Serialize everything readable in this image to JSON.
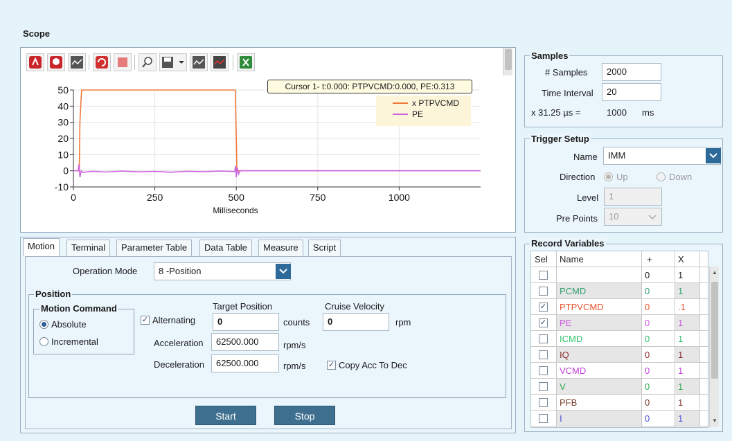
{
  "scope": {
    "title": "Scope"
  },
  "toolbar": {
    "buttons": [
      "record-icon",
      "stop-record-icon",
      "wave-icon",
      "refresh-icon",
      "stop-icon",
      "zoom-icon",
      "save-icon",
      "wave2-icon",
      "wave3-icon",
      "excel-icon"
    ]
  },
  "plot": {
    "cursor_text": "Cursor 1- t:0.000: PTPVCMD:0.000, PE:0.313",
    "legend": [
      {
        "label": "x PTPVCMD",
        "color": "#f07a3c"
      },
      {
        "label": "PE",
        "color": "#cc66dd"
      }
    ],
    "xlabel": "Milliseconds",
    "x_ticks": [
      "0",
      "250",
      "500",
      "750",
      "1000"
    ],
    "y_ticks": [
      "50",
      "40",
      "30",
      "20",
      "10",
      "0",
      "-10"
    ]
  },
  "chart_data": {
    "type": "line",
    "xlabel": "Milliseconds",
    "ylabel": "",
    "xlim": [
      0,
      1250
    ],
    "ylim": [
      -10,
      50
    ],
    "x_ticks": [
      0,
      250,
      500,
      750,
      1000
    ],
    "y_ticks": [
      -10,
      0,
      10,
      20,
      30,
      40,
      50
    ],
    "grid": true,
    "legend_position": "top-right",
    "series": [
      {
        "name": "x PTPVCMD",
        "color": "#f07a3c",
        "x": [
          0,
          18,
          20,
          25,
          28,
          495,
          497,
          500,
          502,
          1250
        ],
        "y": [
          0,
          0,
          30,
          50,
          50,
          50,
          50,
          20,
          0,
          0
        ]
      },
      {
        "name": "PE",
        "color": "#cc66dd",
        "x": [
          0,
          14,
          17,
          20,
          24,
          30,
          60,
          100,
          150,
          200,
          250,
          300,
          350,
          400,
          450,
          495,
          498,
          500,
          503,
          507,
          512,
          520,
          1250
        ],
        "y": [
          0,
          0,
          4,
          -4,
          0,
          -1,
          -0.3,
          -0.8,
          -0.2,
          -0.7,
          -0.4,
          -0.9,
          -0.3,
          -0.6,
          -0.2,
          -0.5,
          3,
          -4,
          2,
          -2,
          0,
          0,
          0
        ]
      }
    ]
  },
  "tabs": [
    "Motion",
    "Terminal",
    "Parameter Table",
    "Data Table",
    "Measure",
    "Script"
  ],
  "motion": {
    "operation_mode_label": "Operation Mode",
    "operation_mode_value": "8 -Position",
    "position_group": "Position",
    "motion_command_group": "Motion Command",
    "absolute_label": "Absolute",
    "incremental_label": "Incremental",
    "alternating_label": "Alternating",
    "target_position_label": "Target Position",
    "target_position_value": "0",
    "target_unit": "counts",
    "cruise_velocity_label": "Cruise Velocity",
    "cruise_velocity_value": "0",
    "cruise_unit": "rpm",
    "acceleration_label": "Acceleration",
    "acceleration_value": "62500.000",
    "acceleration_unit": "rpm/s",
    "deceleration_label": "Deceleration",
    "deceleration_value": "62500.000",
    "deceleration_unit": "rpm/s",
    "copy_acc_label": "Copy Acc To Dec",
    "start_label": "Start",
    "stop_label": "Stop"
  },
  "samples": {
    "title": "Samples",
    "num_samples_label": "# Samples",
    "num_samples_value": "2000",
    "time_interval_label": "Time Interval",
    "time_interval_value": "20",
    "interval_text": "x 31.25 µs =",
    "interval_result": "1000",
    "interval_unit": "ms"
  },
  "trigger": {
    "title": "Trigger Setup",
    "name_label": "Name",
    "name_value": "IMM",
    "direction_label": "Direction",
    "up_label": "Up",
    "down_label": "Down",
    "level_label": "Level",
    "level_value": "1",
    "pre_points_label": "Pre Points",
    "pre_points_value": "10"
  },
  "record": {
    "title": "Record Variables",
    "columns": [
      "Sel",
      "Name",
      "+",
      "X"
    ],
    "rows": [
      {
        "checked": false,
        "name": "",
        "plus": "0",
        "x": "1",
        "color": "#1a1a1a",
        "bg": "#ffffff"
      },
      {
        "checked": false,
        "name": "PCMD",
        "plus": "0",
        "x": "1",
        "color": "#2e9e6a",
        "bg": "#e6e6e6"
      },
      {
        "checked": true,
        "name": "PTPVCMD",
        "plus": "0",
        "x": ".1",
        "color": "#e8522a",
        "bg": "#ffffff"
      },
      {
        "checked": true,
        "name": "PE",
        "plus": "0",
        "x": "1",
        "color": "#cc55dd",
        "bg": "#e6e6e6"
      },
      {
        "checked": false,
        "name": "ICMD",
        "plus": "0",
        "x": "1",
        "color": "#2ec26a",
        "bg": "#ffffff"
      },
      {
        "checked": false,
        "name": "IQ",
        "plus": "0",
        "x": "1",
        "color": "#8a2a2a",
        "bg": "#e6e6e6"
      },
      {
        "checked": false,
        "name": "VCMD",
        "plus": "0",
        "x": "1",
        "color": "#c040d8",
        "bg": "#ffffff"
      },
      {
        "checked": false,
        "name": "V",
        "plus": "0",
        "x": "1",
        "color": "#2aa84a",
        "bg": "#e6e6e6"
      },
      {
        "checked": false,
        "name": "PFB",
        "plus": "0",
        "x": "1",
        "color": "#7a3a2a",
        "bg": "#ffffff"
      },
      {
        "checked": false,
        "name": "I",
        "plus": "0",
        "x": "1",
        "color": "#5050d8",
        "bg": "#e6e6e6"
      }
    ]
  }
}
